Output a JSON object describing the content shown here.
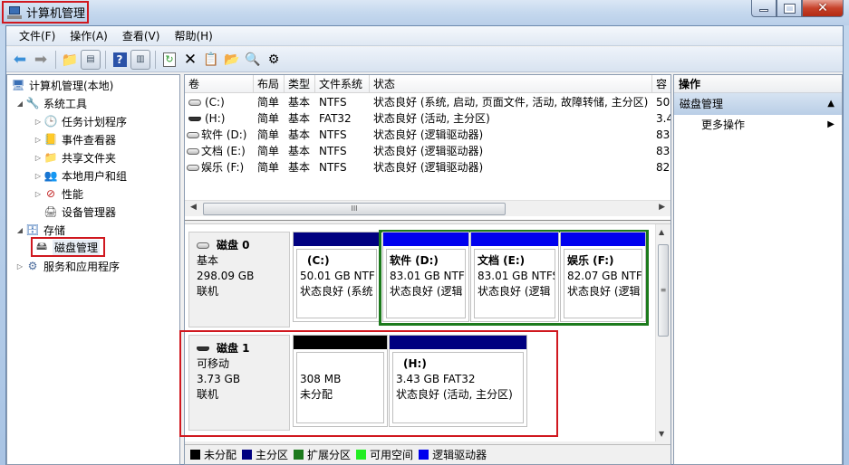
{
  "window": {
    "title": "计算机管理",
    "controls": {
      "minimize": "minimize",
      "maximize": "maximize",
      "close": "close"
    }
  },
  "menubar": {
    "items": [
      "文件(F)",
      "操作(A)",
      "查看(V)",
      "帮助(H)"
    ]
  },
  "toolbar": {
    "buttons": [
      "back-icon",
      "forward-icon",
      "up-folder-icon",
      "show-hide-tree-icon",
      "help-icon",
      "show-hide-action-pane-icon",
      "refresh-icon",
      "delete-icon",
      "properties-icon",
      "open-icon",
      "search-icon",
      "settings-icon"
    ]
  },
  "tree": {
    "root": "计算机管理(本地)",
    "system_tools": "系统工具",
    "task_scheduler": "任务计划程序",
    "event_viewer": "事件查看器",
    "shared_folders": "共享文件夹",
    "local_users": "本地用户和组",
    "performance": "性能",
    "device_manager": "设备管理器",
    "storage": "存储",
    "disk_management": "磁盘管理",
    "services": "服务和应用程序"
  },
  "volumes": {
    "headers": [
      "卷",
      "布局",
      "类型",
      "文件系统",
      "状态",
      "容"
    ],
    "rows": [
      {
        "volume": "(C:)",
        "layout": "简单",
        "type": "基本",
        "fs": "NTFS",
        "status": "状态良好 (系统, 启动, 页面文件, 活动, 故障转储, 主分区)",
        "capacity": "50"
      },
      {
        "volume": "(H:)",
        "layout": "简单",
        "type": "基本",
        "fs": "FAT32",
        "status": "状态良好 (活动, 主分区)",
        "capacity": "3.4"
      },
      {
        "volume": "软件 (D:)",
        "layout": "简单",
        "type": "基本",
        "fs": "NTFS",
        "status": "状态良好 (逻辑驱动器)",
        "capacity": "83"
      },
      {
        "volume": "文档 (E:)",
        "layout": "简单",
        "type": "基本",
        "fs": "NTFS",
        "status": "状态良好 (逻辑驱动器)",
        "capacity": "83"
      },
      {
        "volume": "娱乐 (F:)",
        "layout": "简单",
        "type": "基本",
        "fs": "NTFS",
        "status": "状态良好 (逻辑驱动器)",
        "capacity": "82"
      }
    ],
    "scroll_thumb_glyph": "III"
  },
  "disks": [
    {
      "name": "磁盘 0",
      "kind": "基本",
      "size": "298.09 GB",
      "state": "联机",
      "partitions": [
        {
          "title": "(C:)",
          "size": "50.01 GB NTF",
          "status": "状态良好 (系统",
          "bar_color": "#000080"
        },
        {
          "title": "软件  (D:)",
          "size": "83.01 GB NTF",
          "status": "状态良好 (逻辑",
          "bar_color": "#0000ee"
        },
        {
          "title": "文档  (E:)",
          "size": "83.01 GB NTFS",
          "status": "状态良好 (逻辑",
          "bar_color": "#0000ee"
        },
        {
          "title": "娱乐  (F:)",
          "size": "82.07 GB NTF",
          "status": "状态良好 (逻辑",
          "bar_color": "#0000ee"
        }
      ]
    },
    {
      "name": "磁盘 1",
      "kind": "可移动",
      "size": "3.73 GB",
      "state": "联机",
      "partitions": [
        {
          "title": "",
          "size": "308 MB",
          "status": "未分配",
          "bar_color": "#000000"
        },
        {
          "title": "(H:)",
          "size": "3.43 GB FAT32",
          "status": "状态良好 (活动, 主分区)",
          "bar_color": "#000080"
        }
      ]
    }
  ],
  "legend": [
    {
      "label": "未分配",
      "color": "#000000"
    },
    {
      "label": "主分区",
      "color": "#000080"
    },
    {
      "label": "扩展分区",
      "color": "#1c7a1c"
    },
    {
      "label": "可用空间",
      "color": "#22ee22"
    },
    {
      "label": "逻辑驱动器",
      "color": "#0000ee"
    }
  ],
  "actions": {
    "header": "操作",
    "section": "磁盘管理",
    "more": "更多操作"
  },
  "colors": {
    "highlight_box": "#d0181f",
    "extended_partition_border": "#1c7a1c"
  }
}
